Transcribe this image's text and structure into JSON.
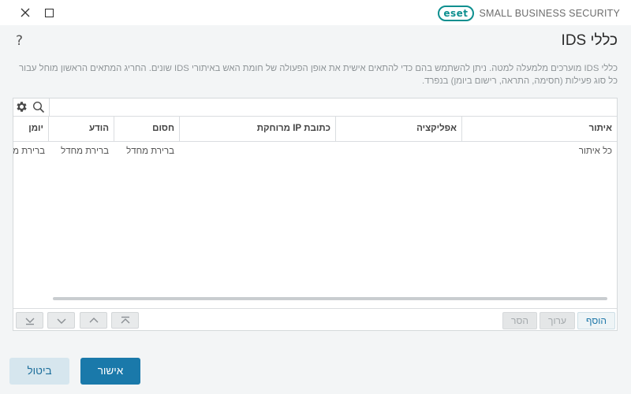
{
  "window": {
    "brand_logo": "eset",
    "brand_text": "SMALL BUSINESS SECURITY",
    "close_icon": "close-icon",
    "maximize_icon": "maximize-icon"
  },
  "header": {
    "title": "כללי IDS",
    "help": "?"
  },
  "description": "כללי IDS מוערכים מלמעלה למטה. ניתן להשתמש בהם כדי להתאים אישית את אופן הפעולה של חומת האש באיתורי IDS שונים. החריג המתאים הראשון מוחל עבור כל סוג פעילות (חסימה, התראה, רישום ביומן) בנפרד.",
  "toolbar": {
    "gear_icon": "gear-icon",
    "search_icon": "search-icon",
    "filter_placeholder": ""
  },
  "table": {
    "columns": [
      "איתור",
      "אפליקציה",
      "כתובת IP מרוחקת",
      "חסום",
      "הודע",
      "יומן"
    ],
    "rows": [
      [
        "כל איתור",
        "",
        "",
        "ברירת מחדל",
        "ברירת מחדל",
        "ברירת מחדל"
      ]
    ]
  },
  "list_buttons": {
    "add": "הוסף",
    "edit": "ערוך",
    "remove": "הסר"
  },
  "nav_icons": [
    "move-top-icon",
    "move-up-icon",
    "move-down-icon",
    "move-bottom-icon"
  ],
  "footer": {
    "ok": "אישור",
    "cancel": "ביטול"
  },
  "colors": {
    "accent": "#1a79aa",
    "brand": "#0d8f8f",
    "background": "#f3f5f6"
  }
}
